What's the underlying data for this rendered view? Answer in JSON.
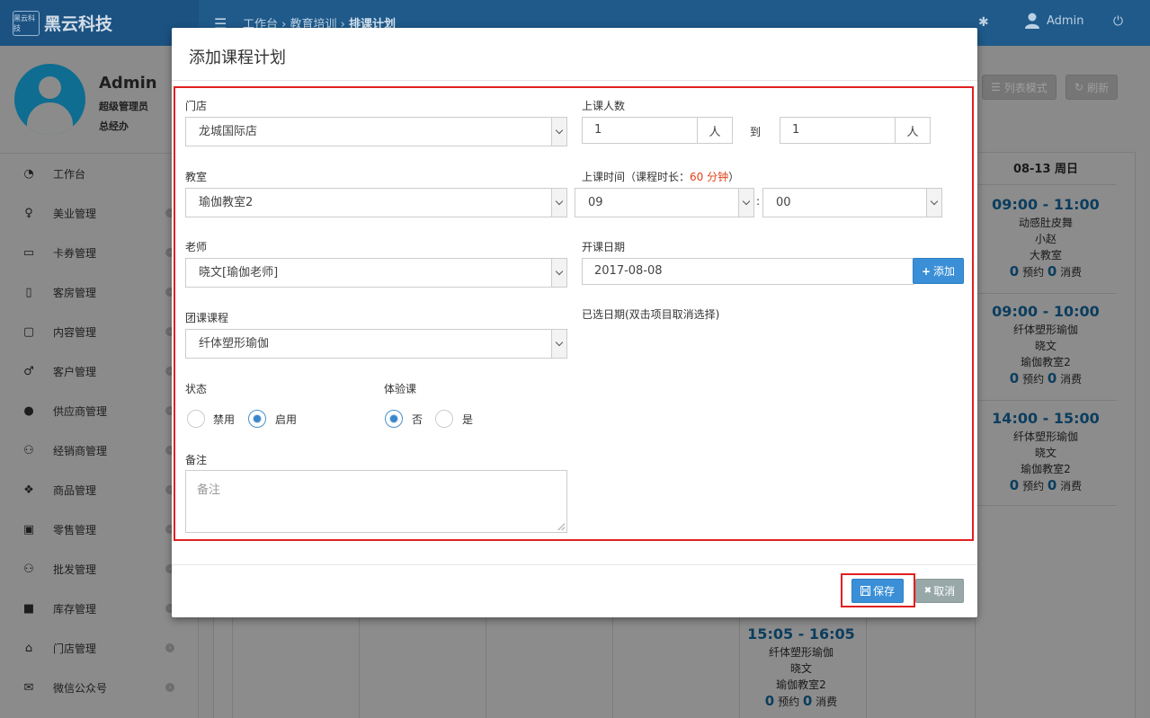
{
  "app": {
    "logo_badge": "黑云科技",
    "logo_text": "黑云科技",
    "breadcrumb": {
      "item1": "工作台",
      "sep1": " › ",
      "item2": "教育培训",
      "sep2": " › ",
      "item3": "排课计划"
    },
    "user_name": "Admin"
  },
  "profile": {
    "name": "Admin",
    "role": "超级管理员",
    "dept": "总经办"
  },
  "sidebar": {
    "items": [
      {
        "label": "工作台",
        "icon": "dashboard-icon",
        "glyph": "◔"
      },
      {
        "label": "美业管理",
        "icon": "female-icon",
        "glyph": "♀"
      },
      {
        "label": "卡券管理",
        "icon": "card-icon",
        "glyph": "▭"
      },
      {
        "label": "客房管理",
        "icon": "building-icon",
        "glyph": "▯"
      },
      {
        "label": "内容管理",
        "icon": "file-icon",
        "glyph": "▢"
      },
      {
        "label": "客户管理",
        "icon": "male-icon",
        "glyph": "♂"
      },
      {
        "label": "供应商管理",
        "icon": "user-icon",
        "glyph": "●"
      },
      {
        "label": "经销商管理",
        "icon": "users-icon",
        "glyph": "⚇"
      },
      {
        "label": "商品管理",
        "icon": "cubes-icon",
        "glyph": "❖"
      },
      {
        "label": "零售管理",
        "icon": "money-icon",
        "glyph": "▣"
      },
      {
        "label": "批发管理",
        "icon": "group-icon",
        "glyph": "⚇"
      },
      {
        "label": "库存管理",
        "icon": "archive-icon",
        "glyph": "■"
      },
      {
        "label": "门店管理",
        "icon": "home-icon",
        "glyph": "⌂"
      },
      {
        "label": "微信公众号",
        "icon": "wechat-icon",
        "glyph": "✉"
      }
    ]
  },
  "toolbar": {
    "list_mode": "列表模式",
    "refresh": "刷新"
  },
  "calendar": {
    "col_header": "08-13 周日",
    "events": [
      {
        "time": "09:00 - 11:00",
        "course": "动感肚皮舞",
        "teacher": "小赵",
        "room": "大教室",
        "booked": "0",
        "booked_label": "预约",
        "used": "0",
        "used_label": "消费"
      },
      {
        "time": "09:00 - 10:00",
        "course": "纤体塑形瑜伽",
        "teacher": "晓文",
        "room": "瑜伽教室2",
        "booked": "0",
        "booked_label": "预约",
        "used": "0",
        "used_label": "消费"
      },
      {
        "time": "14:00 - 15:00",
        "course": "纤体塑形瑜伽",
        "teacher": "晓文",
        "room": "瑜伽教室2",
        "booked": "0",
        "booked_label": "预约",
        "used": "0",
        "used_label": "消费"
      },
      {
        "time": "15:05 - 16:05",
        "course": "纤体塑形瑜伽",
        "teacher": "晓文",
        "room": "瑜伽教室2",
        "booked": "0",
        "booked_label": "预约",
        "used": "0",
        "used_label": "消费"
      }
    ]
  },
  "modal": {
    "title": "添加课程计划",
    "store_label": "门店",
    "store_value": "龙城国际店",
    "room_label": "教室",
    "room_value": "瑜伽教室2",
    "teacher_label": "老师",
    "teacher_value": "晓文[瑜伽老师]",
    "course_label": "团课课程",
    "course_value": "纤体塑形瑜伽",
    "status_label": "状态",
    "status_options": [
      "禁用",
      "启用"
    ],
    "status_selected": "启用",
    "trial_label": "体验课",
    "trial_options": [
      "否",
      "是"
    ],
    "trial_selected": "否",
    "note_label": "备注",
    "note_placeholder": "备注",
    "capacity_label": "上课人数",
    "capacity_min": "1",
    "capacity_max": "1",
    "capacity_unit": "人",
    "capacity_to": "到",
    "time_label_prefix": "上课时间（课程时长：",
    "duration": "60 分钟",
    "time_label_suffix": "）",
    "time_hour": "09",
    "time_colon": ":",
    "time_minute": "00",
    "start_date_label": "开课日期",
    "start_date_value": "2017-08-08",
    "add_button": "添加",
    "selected_dates_label": "已选日期(双击项目取消选择)",
    "save_button": "保存",
    "cancel_button": "取消"
  },
  "colors": {
    "primary": "#3a8fd6",
    "highlight": "#e02020",
    "accent_text": "#e0401a"
  }
}
